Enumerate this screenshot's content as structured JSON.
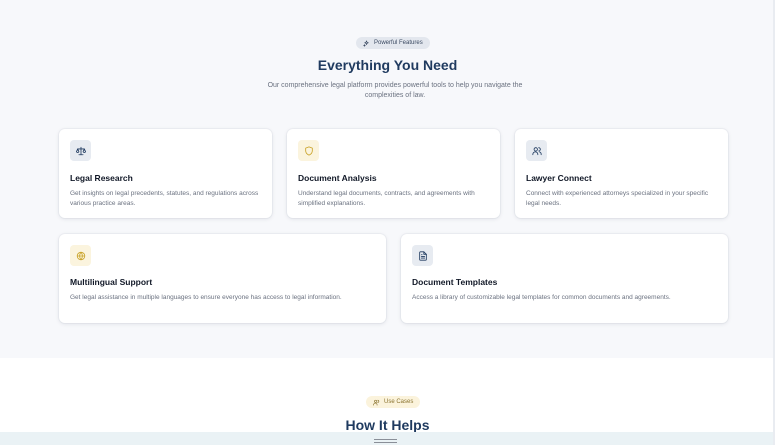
{
  "features_section": {
    "badge_label": "Powerful Features",
    "badge_icon": "sparkles-icon",
    "title": "Everything You Need",
    "subtitle": "Our comprehensive legal platform provides powerful tools to help you navigate the complexities of law."
  },
  "feature_cards": [
    {
      "icon": "scale-icon",
      "title": "Legal Research",
      "description": "Get insights on legal precedents, statutes, and regulations across various practice areas."
    },
    {
      "icon": "shield-icon",
      "title": "Document Analysis",
      "description": "Understand legal documents, contracts, and agreements with simplified explanations."
    },
    {
      "icon": "users-icon",
      "title": "Lawyer Connect",
      "description": "Connect with experienced attorneys specialized in your specific legal needs."
    },
    {
      "icon": "globe-icon",
      "title": "Multilingual Support",
      "description": "Get legal assistance in multiple languages to ensure everyone has access to legal information."
    },
    {
      "icon": "file-text-icon",
      "title": "Document Templates",
      "description": "Access a library of customizable legal templates for common documents and agreements."
    }
  ],
  "use_cases_section": {
    "badge_label": "Use Cases",
    "badge_icon": "users-icon",
    "title": "How It Helps"
  },
  "colors": {
    "navy": "#1f3a5f",
    "gold": "#c9a227",
    "card_bg": "#ffffff",
    "section_bg": "#f7f8fb"
  }
}
